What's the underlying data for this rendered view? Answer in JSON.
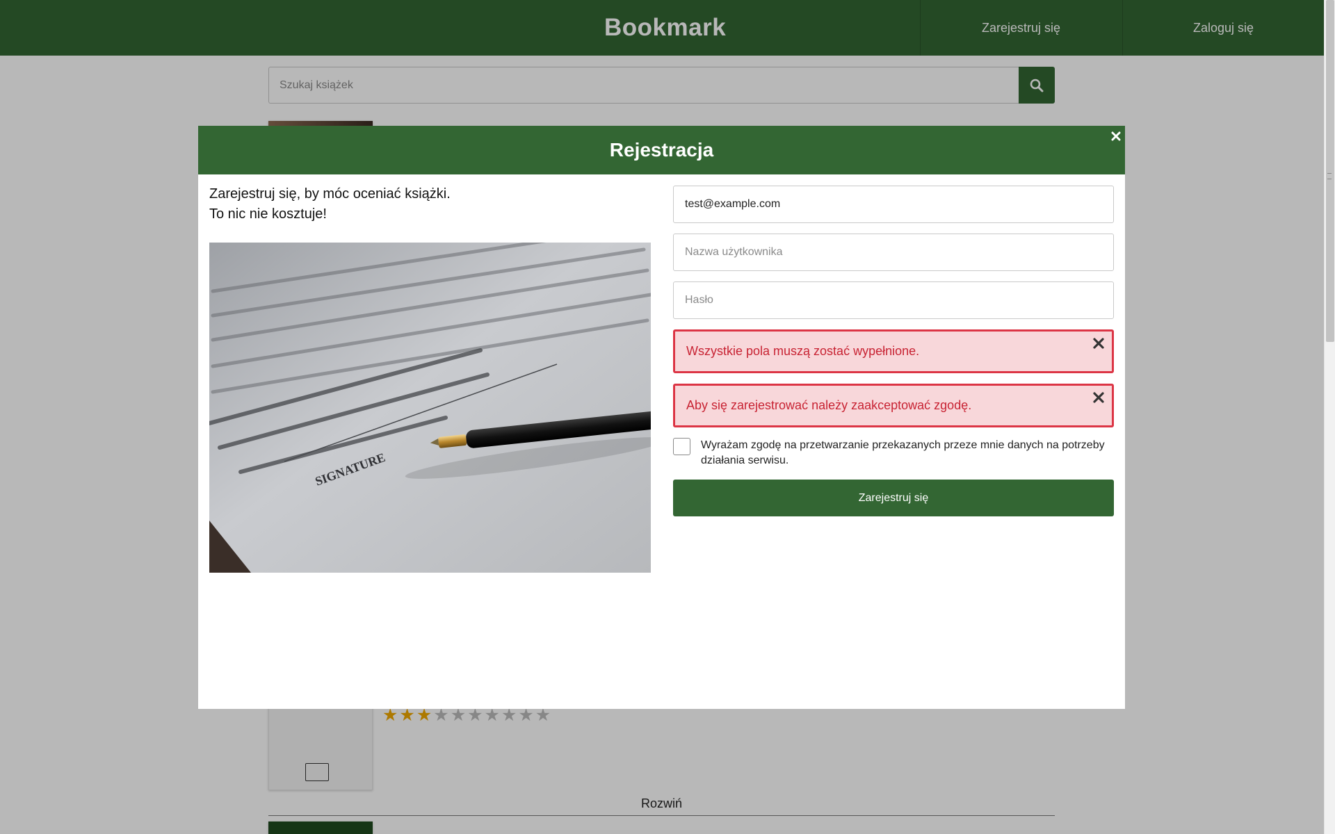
{
  "navbar": {
    "brand": "Bookmark",
    "register_label": "Zarejestruj się",
    "login_label": "Zaloguj się"
  },
  "search": {
    "placeholder": "Szukaj książek",
    "icon": "search-icon"
  },
  "book_list": {
    "rating": {
      "value": 3,
      "max": 10
    },
    "expand_label": "Rozwiń"
  },
  "modal": {
    "title": "Rejestracja",
    "close_icon": "close-icon",
    "intro_line1": "Zarejestruj się, by móc oceniać książki.",
    "intro_line2": "To nic nie kosztuje!",
    "photo_text": "SIGNATURE",
    "form": {
      "email_value": "test@example.com",
      "username_placeholder": "Nazwa użytkownika",
      "password_placeholder": "Hasło",
      "errors": [
        "Wszystkie pola muszą zostać wypełnione.",
        "Aby się zarejestrować należy zaakceptować zgodę."
      ],
      "consent_label": "Wyrażam zgodę na przetwarzanie przekazanych przeze mnie danych na potrzeby działania serwisu.",
      "consent_checked": false,
      "submit_label": "Zarejestruj się"
    }
  },
  "colors": {
    "primary_green": "#336633",
    "error_border": "#dc3545",
    "error_bg": "#f8d7da",
    "star_on": "#f0a800",
    "star_off": "#bbbbbb"
  }
}
